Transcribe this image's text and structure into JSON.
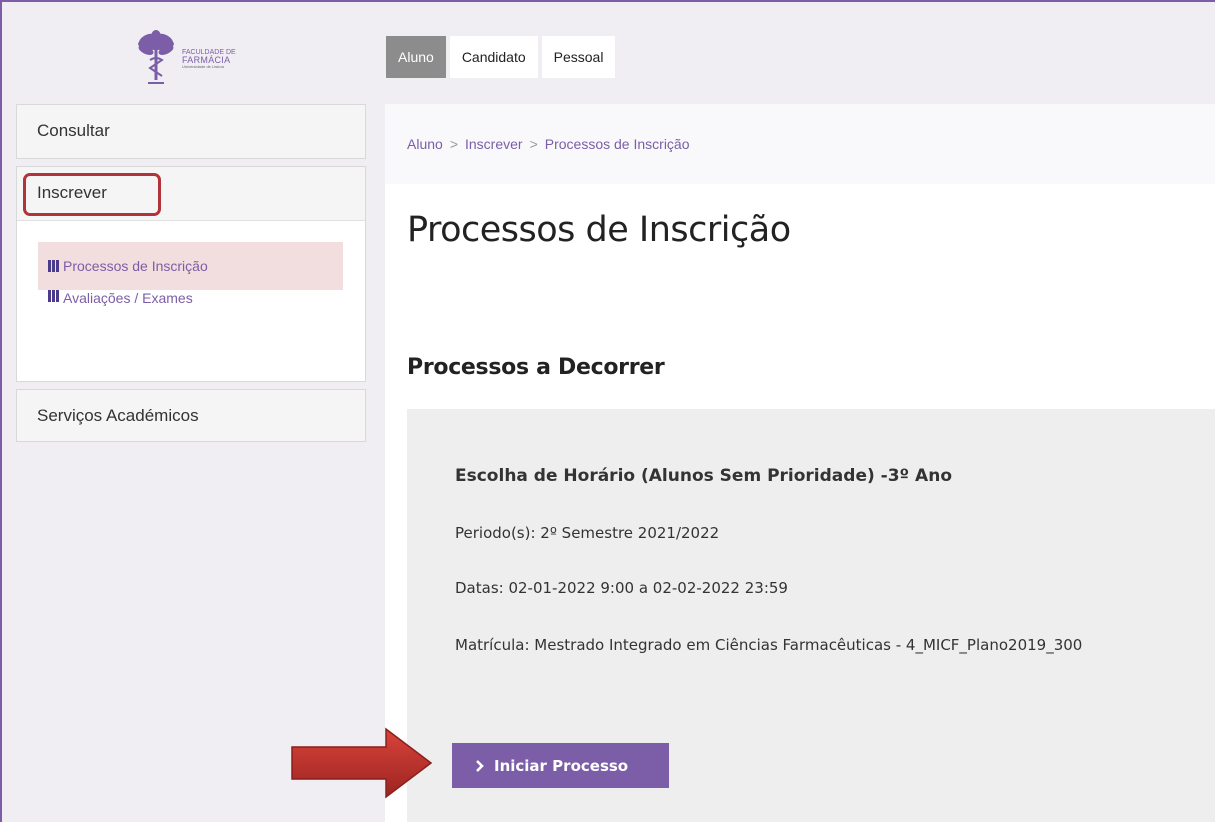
{
  "header": {
    "logo": {
      "line1": "FACULDADE DE",
      "line2": "FARMÁCIA",
      "line3": "Universidade de Lisboa"
    },
    "tabs": [
      {
        "label": "Aluno",
        "active": true
      },
      {
        "label": "Candidato",
        "active": false
      },
      {
        "label": "Pessoal",
        "active": false
      }
    ]
  },
  "sidebar": {
    "consultar": "Consultar",
    "inscrever": "Inscrever",
    "sub_items": [
      {
        "label": "Processos de Inscrição",
        "selected": true
      },
      {
        "label": "Avaliações / Exames",
        "selected": false
      }
    ],
    "servicos": "Serviços Académicos"
  },
  "breadcrumb": {
    "items": [
      "Aluno",
      "Inscrever",
      "Processos de Inscrição"
    ],
    "separator": ">"
  },
  "main": {
    "page_title": "Processos de Inscrição",
    "section_title": "Processos a Decorrer",
    "process": {
      "title": "Escolha de Horário (Alunos Sem Prioridade) -3º Ano",
      "periodo": "Periodo(s): 2º Semestre 2021/2022",
      "datas": "Datas: 02-01-2022 9:00 a 02-02-2022 23:59",
      "matricula": "Matrícula: Mestrado Integrado em Ciências Farmacêuticas - 4_MICF_Plano2019_300",
      "button_label": "Iniciar Processo"
    }
  },
  "colors": {
    "accent": "#7b5ea7",
    "highlight": "#b0343a",
    "arrow": "#c0302c"
  }
}
